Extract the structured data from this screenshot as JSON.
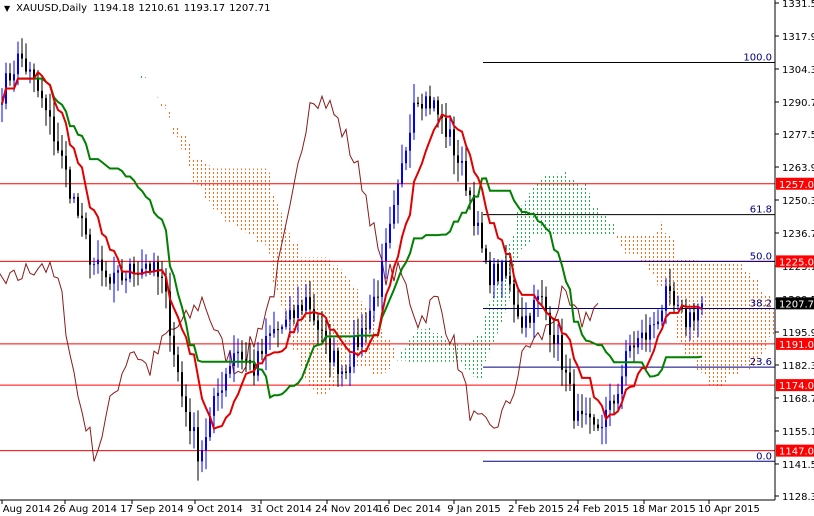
{
  "header": {
    "menu_icon": "triangle-down-icon",
    "symbol": "XAUUSD,Daily",
    "open": "1194.18",
    "high": "1210.61",
    "low": "1193.17",
    "close": "1207.71"
  },
  "chart_data": {
    "type": "candlestick",
    "title": "XAUUSD,Daily",
    "ylim": [
      1128.3,
      1331.5
    ],
    "y_ticks": [
      "1331.50",
      "1317.90",
      "1304.30",
      "1290.70",
      "1277.50",
      "1263.90",
      "1250.30",
      "1236.70",
      "1223.10",
      "1209.50",
      "1195.90",
      "1182.30",
      "1168.70",
      "1155.10",
      "1141.50",
      "1128.30"
    ],
    "x_ticks": [
      "4 Aug 2014",
      "26 Aug 2014",
      "17 Sep 2014",
      "9 Oct 2014",
      "31 Oct 2014",
      "24 Nov 2014",
      "16 Dec 2014",
      "9 Jan 2015",
      "2 Feb 2015",
      "24 Feb 2015",
      "18 Mar 2015",
      "10 Apr 2015"
    ],
    "price_path": [
      1295,
      1310,
      1295,
      1275,
      1250,
      1225,
      1215,
      1220,
      1225,
      1215,
      1170,
      1145,
      1170,
      1190,
      1180,
      1195,
      1200,
      1210,
      1190,
      1180,
      1195,
      1215,
      1250,
      1295,
      1290,
      1275,
      1255,
      1220,
      1220,
      1200,
      1210,
      1190,
      1160,
      1155,
      1165,
      1190,
      1195,
      1210,
      1200,
      1207.71
    ],
    "current_price": "1207.71",
    "levels": [
      {
        "price": 1257,
        "label": "1257.00"
      },
      {
        "price": 1225,
        "label": "1225.00"
      },
      {
        "price": 1191,
        "label": "1191.00"
      },
      {
        "price": 1174,
        "label": "1174.00"
      },
      {
        "price": 1147,
        "label": "1147.00"
      }
    ],
    "fibonacci": [
      {
        "label": "100.0",
        "price": 1307.0
      },
      {
        "label": "61.8",
        "price": 1244.3
      },
      {
        "label": "50.0",
        "price": 1225.0
      },
      {
        "label": "38.2",
        "price": 1205.6
      },
      {
        "label": "23.6",
        "price": 1181.4
      },
      {
        "label": "0.0",
        "price": 1142.6
      }
    ],
    "colors": {
      "bull": "#0000ff",
      "bear": "#000000",
      "tenkan": "#e00000",
      "kijun": "#008000",
      "chikou": "#8b1a1a",
      "cloud_bear": "#ff6a1a",
      "cloud_bull": "#20b050",
      "level": "#ff0000",
      "fib": "#000080",
      "label_bg": "#ff0000"
    }
  }
}
